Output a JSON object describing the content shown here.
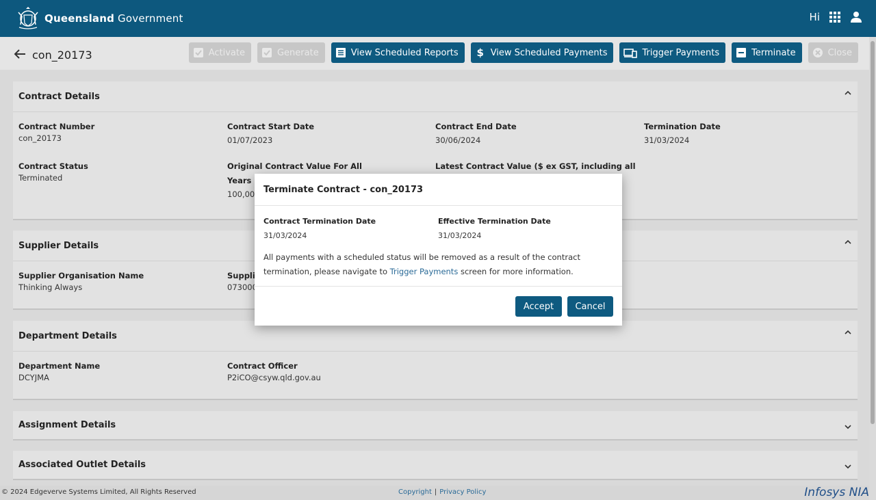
{
  "header": {
    "brand_bold": "Queensland",
    "brand_rest": "Government",
    "greeting": "Hi"
  },
  "titlebar": {
    "back_label": "back",
    "title": "con_20173",
    "actions": [
      {
        "label": "Activate",
        "icon": "check-square-icon",
        "disabled": true
      },
      {
        "label": "Generate",
        "icon": "check-square-icon",
        "disabled": true
      },
      {
        "label": "View Scheduled Reports",
        "icon": "list-icon",
        "disabled": false
      },
      {
        "label": "View Scheduled Payments",
        "icon": "dollar-icon",
        "disabled": false
      },
      {
        "label": "Trigger Payments",
        "icon": "devices-icon",
        "disabled": false
      },
      {
        "label": "Terminate",
        "icon": "minus-box-icon",
        "disabled": false
      },
      {
        "label": "Close",
        "icon": "close-circle-icon",
        "disabled": true
      }
    ]
  },
  "contract_details": {
    "heading": "Contract Details",
    "contract_number_label": "Contract Number",
    "contract_number": "con_20173",
    "start_date_label": "Contract Start Date",
    "start_date": "01/07/2023",
    "end_date_label": "Contract End Date",
    "end_date": "30/06/2024",
    "termination_date_label": "Termination Date",
    "termination_date": "31/03/2024",
    "status_label": "Contract Status",
    "status": "Terminated",
    "original_value_label_line1": "Original Contract Value For All",
    "original_value_label_line2": "Years (",
    "original_value": "100,00",
    "latest_value_label": "Latest Contract Value ($ ex GST, including all"
  },
  "supplier_details": {
    "heading": "Supplier Details",
    "org_name_label": "Supplier Organisation Name",
    "org_name": "Thinking Always",
    "second_label": "Supplie",
    "second_value": "073000"
  },
  "department_details": {
    "heading": "Department Details",
    "dept_name_label": "Department Name",
    "dept_name": "DCYJMA",
    "officer_label": "Contract Officer",
    "officer": "P2iCO@csyw.qld.gov.au"
  },
  "assignment_details": {
    "heading": "Assignment Details"
  },
  "outlet_details": {
    "heading": "Associated Outlet Details"
  },
  "footer": {
    "copyright": "© 2024 Edgeverve Systems Limited, All Rights Reserved",
    "copyright_link": "Copyright",
    "separator": "|",
    "privacy_link": "Privacy Policy",
    "logo": "Infosys NIA"
  },
  "modal": {
    "title": "Terminate Contract - con_20173",
    "termination_date_label": "Contract Termination Date",
    "termination_date": "31/03/2024",
    "effective_date_label": "Effective Termination Date",
    "effective_date": "31/03/2024",
    "message_before": "All payments with a scheduled status will be removed as a result of the contract termination, please navigate to ",
    "message_link": "Trigger Payments",
    "message_after": " screen for more information.",
    "accept_label": "Accept",
    "cancel_label": "Cancel"
  }
}
